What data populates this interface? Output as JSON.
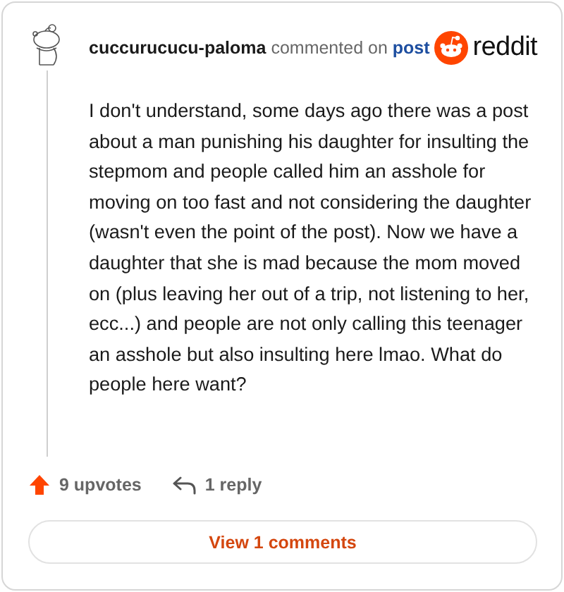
{
  "header": {
    "username": "cuccurucucu-paloma",
    "action": "commented on",
    "link": "post",
    "logo_text": "reddit"
  },
  "comment": {
    "text": "I don't understand, some days ago there was a post about a man punishing his daughter for insulting the stepmom and people called him an asshole for moving on too fast and not considering the daughter (wasn't even the point of the post). Now we have a daughter that she is mad because the mom moved on (plus leaving her out of a trip, not listening to her, ecc...) and people are not only calling this teenager an asshole but also insulting here lmao. What do people here want?"
  },
  "footer": {
    "upvotes": "9 upvotes",
    "replies": "1 reply",
    "button": "View 1 comments"
  }
}
